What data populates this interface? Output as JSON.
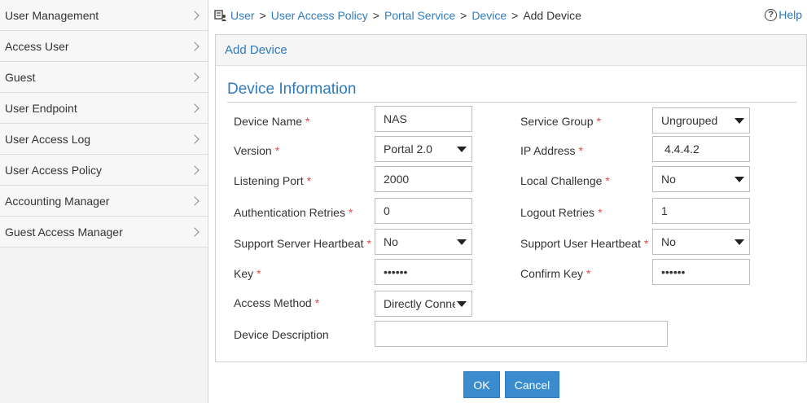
{
  "sidebar": {
    "items": [
      {
        "label": "User Management"
      },
      {
        "label": "Access User"
      },
      {
        "label": "Guest"
      },
      {
        "label": "User Endpoint"
      },
      {
        "label": "User Access Log"
      },
      {
        "label": "User Access Policy"
      },
      {
        "label": "Accounting Manager"
      },
      {
        "label": "Guest Access Manager"
      }
    ]
  },
  "breadcrumb": {
    "items": [
      "User",
      "User Access Policy",
      "Portal Service",
      "Device"
    ],
    "current": "Add Device",
    "separator": ">"
  },
  "help": {
    "label": "Help",
    "glyph": "?"
  },
  "panel": {
    "title": "Add Device",
    "section_title": "Device Information"
  },
  "form": {
    "required_mark": "*",
    "device_name": {
      "label": "Device Name",
      "value": "NAS"
    },
    "version": {
      "label": "Version",
      "value": "Portal 2.0"
    },
    "listening_port": {
      "label": "Listening Port",
      "value": "2000"
    },
    "auth_retries": {
      "label": "Authentication Retries",
      "value": "0"
    },
    "server_heartbeat": {
      "label": "Support Server Heartbeat",
      "value": "No"
    },
    "key": {
      "label": "Key",
      "value": "••••••"
    },
    "access_method": {
      "label": "Access Method",
      "value": "Directly Connected"
    },
    "device_description": {
      "label": "Device Description",
      "value": ""
    },
    "service_group": {
      "label": "Service Group",
      "value": "Ungrouped"
    },
    "ip_address": {
      "label": "IP Address",
      "value": "4.4.4.2"
    },
    "local_challenge": {
      "label": "Local Challenge",
      "value": "No"
    },
    "logout_retries": {
      "label": "Logout Retries",
      "value": "1"
    },
    "user_heartbeat": {
      "label": "Support User Heartbeat",
      "value": "No"
    },
    "confirm_key": {
      "label": "Confirm Key",
      "value": "••••••"
    }
  },
  "buttons": {
    "ok": "OK",
    "cancel": "Cancel"
  },
  "colors": {
    "accent": "#2f7bbf",
    "button": "#3a8cce",
    "required": "#e04848"
  }
}
